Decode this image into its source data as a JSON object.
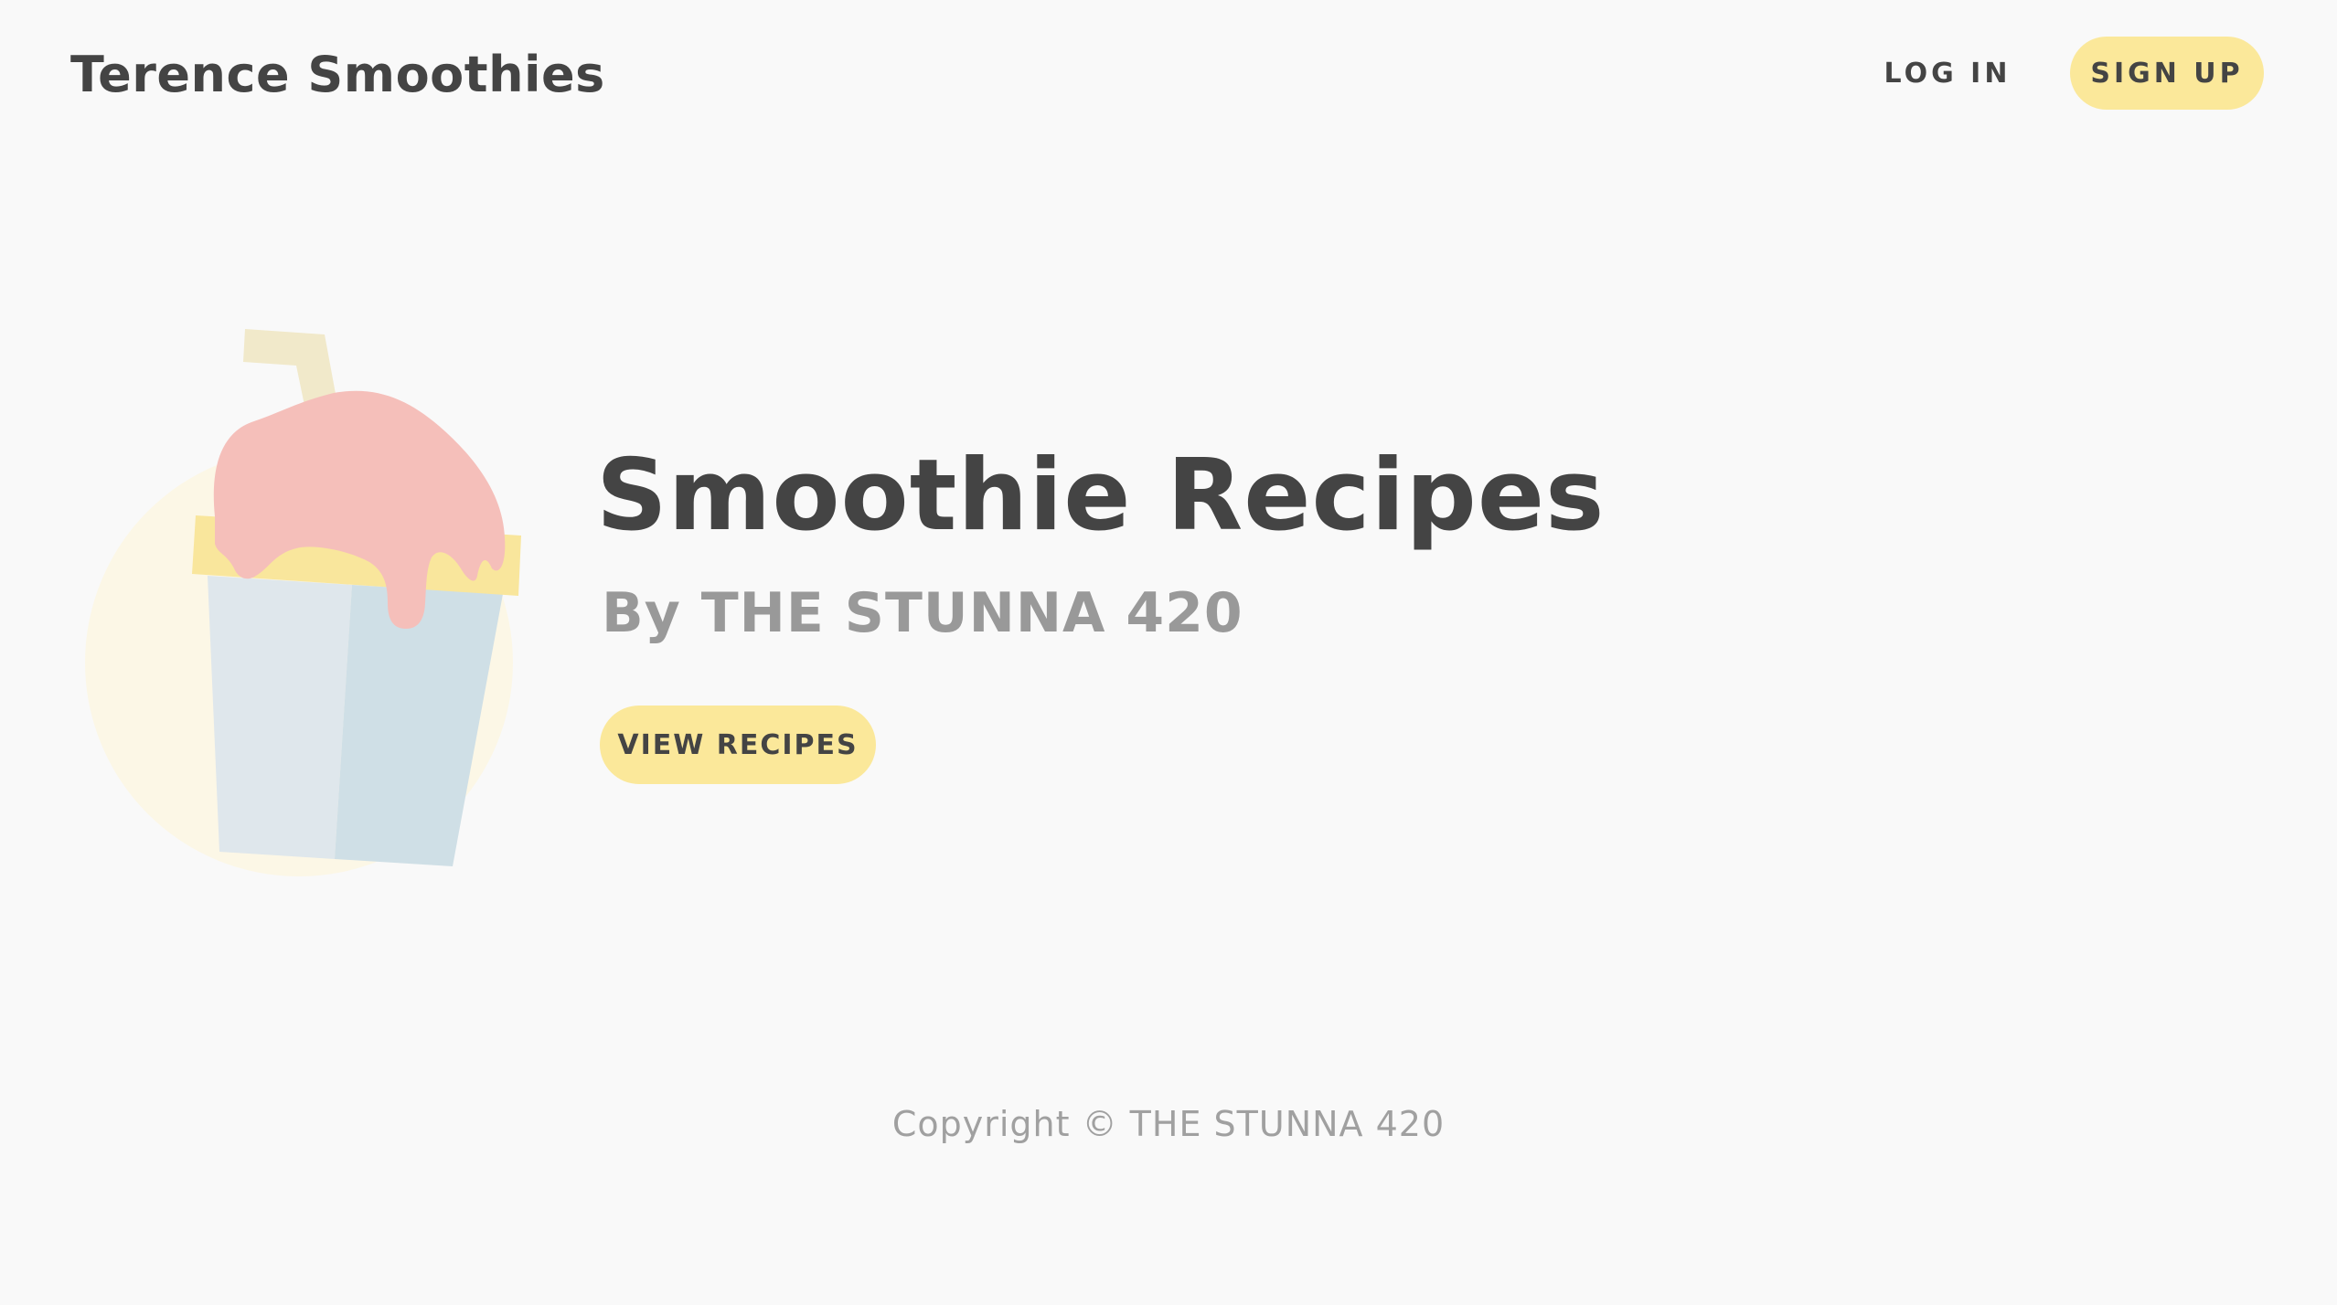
{
  "header": {
    "brand": "Terence Smoothies",
    "login_label": "LOG IN",
    "signup_label": "SIGN UP"
  },
  "hero": {
    "title": "Smoothie Recipes",
    "subtitle": "By THE STUNNA 420",
    "cta_label": "VIEW RECIPES",
    "illustration_icon": "smoothie-cup-icon"
  },
  "footer": {
    "copyright": "Copyright © THE STUNNA 420"
  },
  "colors": {
    "background": "#f9f9f9",
    "accent": "#fbe89a",
    "text_primary": "#444444",
    "text_secondary": "#999999",
    "illustration_circle": "#fcf7e6",
    "illustration_straw": "#f1e9ca",
    "illustration_topping": "#f5bfba",
    "illustration_lid": "#f9e69c",
    "illustration_cup_light": "#dfe7ec",
    "illustration_cup_dark": "#cfdfe6"
  }
}
